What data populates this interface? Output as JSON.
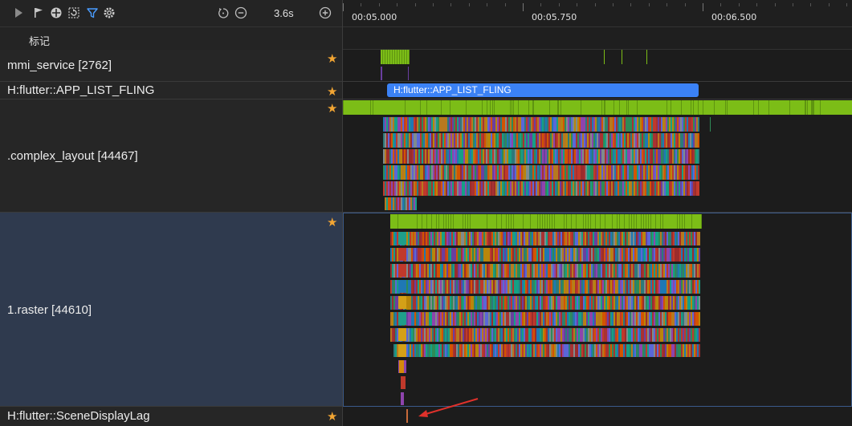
{
  "toolbar": {
    "icons": [
      "play-icon",
      "flag-icon",
      "crosshair-icon",
      "refresh-select-icon",
      "filter-icon",
      "settings-icon",
      "reset-icon",
      "zoom-out-icon",
      "zoom-in-icon"
    ],
    "zoom_label": "3.6s"
  },
  "marks": {
    "label": "标记"
  },
  "ruler": {
    "ticks": [
      "00:05.000",
      "00:05.750",
      "00:06.500"
    ]
  },
  "lanes": [
    {
      "name": "mmi_service [2762]",
      "starred": true
    },
    {
      "name": "H:flutter::APP_LIST_FLING",
      "starred": true
    },
    {
      "name": ".complex_layout [44467]",
      "starred": true
    },
    {
      "name": "1.raster [44610]",
      "starred": true,
      "selected": true
    },
    {
      "name": "H:flutter::SceneDisplayLag",
      "starred": true
    }
  ],
  "slices": {
    "app_list_fling": "H:flutter::APP_LIST_FLING"
  },
  "colors": {
    "accent": "#3b82f6",
    "cpu_green": "#7cbd17",
    "star": "#f2a533",
    "annotation_arrow": "#e0312b"
  }
}
